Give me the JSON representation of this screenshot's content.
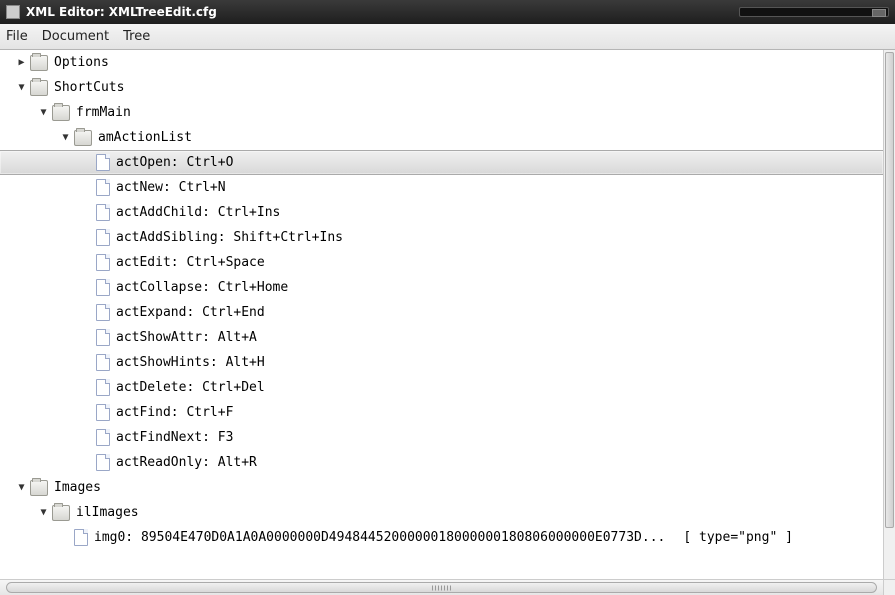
{
  "window": {
    "title": "XML Editor: XMLTreeEdit.cfg"
  },
  "menu": {
    "file": "File",
    "document": "Document",
    "tree": "Tree"
  },
  "tree": {
    "nodes": [
      {
        "depth": 0,
        "icon": "folder",
        "expander": "right",
        "label": "Options",
        "selected": false
      },
      {
        "depth": 0,
        "icon": "folder",
        "expander": "down",
        "label": "ShortCuts",
        "selected": false
      },
      {
        "depth": 1,
        "icon": "folder",
        "expander": "down",
        "label": "frmMain",
        "selected": false
      },
      {
        "depth": 2,
        "icon": "folder",
        "expander": "down",
        "label": "amActionList",
        "selected": false
      },
      {
        "depth": 3,
        "icon": "file",
        "expander": "none",
        "label": "actOpen: Ctrl+O",
        "selected": true
      },
      {
        "depth": 3,
        "icon": "file",
        "expander": "none",
        "label": "actNew: Ctrl+N",
        "selected": false
      },
      {
        "depth": 3,
        "icon": "file",
        "expander": "none",
        "label": "actAddChild: Ctrl+Ins",
        "selected": false
      },
      {
        "depth": 3,
        "icon": "file",
        "expander": "none",
        "label": "actAddSibling: Shift+Ctrl+Ins",
        "selected": false
      },
      {
        "depth": 3,
        "icon": "file",
        "expander": "none",
        "label": "actEdit: Ctrl+Space",
        "selected": false
      },
      {
        "depth": 3,
        "icon": "file",
        "expander": "none",
        "label": "actCollapse: Ctrl+Home",
        "selected": false
      },
      {
        "depth": 3,
        "icon": "file",
        "expander": "none",
        "label": "actExpand: Ctrl+End",
        "selected": false
      },
      {
        "depth": 3,
        "icon": "file",
        "expander": "none",
        "label": "actShowAttr: Alt+A",
        "selected": false
      },
      {
        "depth": 3,
        "icon": "file",
        "expander": "none",
        "label": "actShowHints: Alt+H",
        "selected": false
      },
      {
        "depth": 3,
        "icon": "file",
        "expander": "none",
        "label": "actDelete: Ctrl+Del",
        "selected": false
      },
      {
        "depth": 3,
        "icon": "file",
        "expander": "none",
        "label": "actFind: Ctrl+F",
        "selected": false
      },
      {
        "depth": 3,
        "icon": "file",
        "expander": "none",
        "label": "actFindNext: F3",
        "selected": false
      },
      {
        "depth": 3,
        "icon": "file",
        "expander": "none",
        "label": "actReadOnly: Alt+R",
        "selected": false
      },
      {
        "depth": 0,
        "icon": "folder",
        "expander": "down",
        "label": "Images",
        "selected": false
      },
      {
        "depth": 1,
        "icon": "folder",
        "expander": "down",
        "label": "ilImages",
        "selected": false
      },
      {
        "depth": 2,
        "icon": "file",
        "expander": "none",
        "label": "img0: 89504E470D0A1A0A0000000D4948445200000018000000180806000000E0773D...",
        "attrs": "[ type=\"png\" ]",
        "selected": false
      }
    ]
  }
}
